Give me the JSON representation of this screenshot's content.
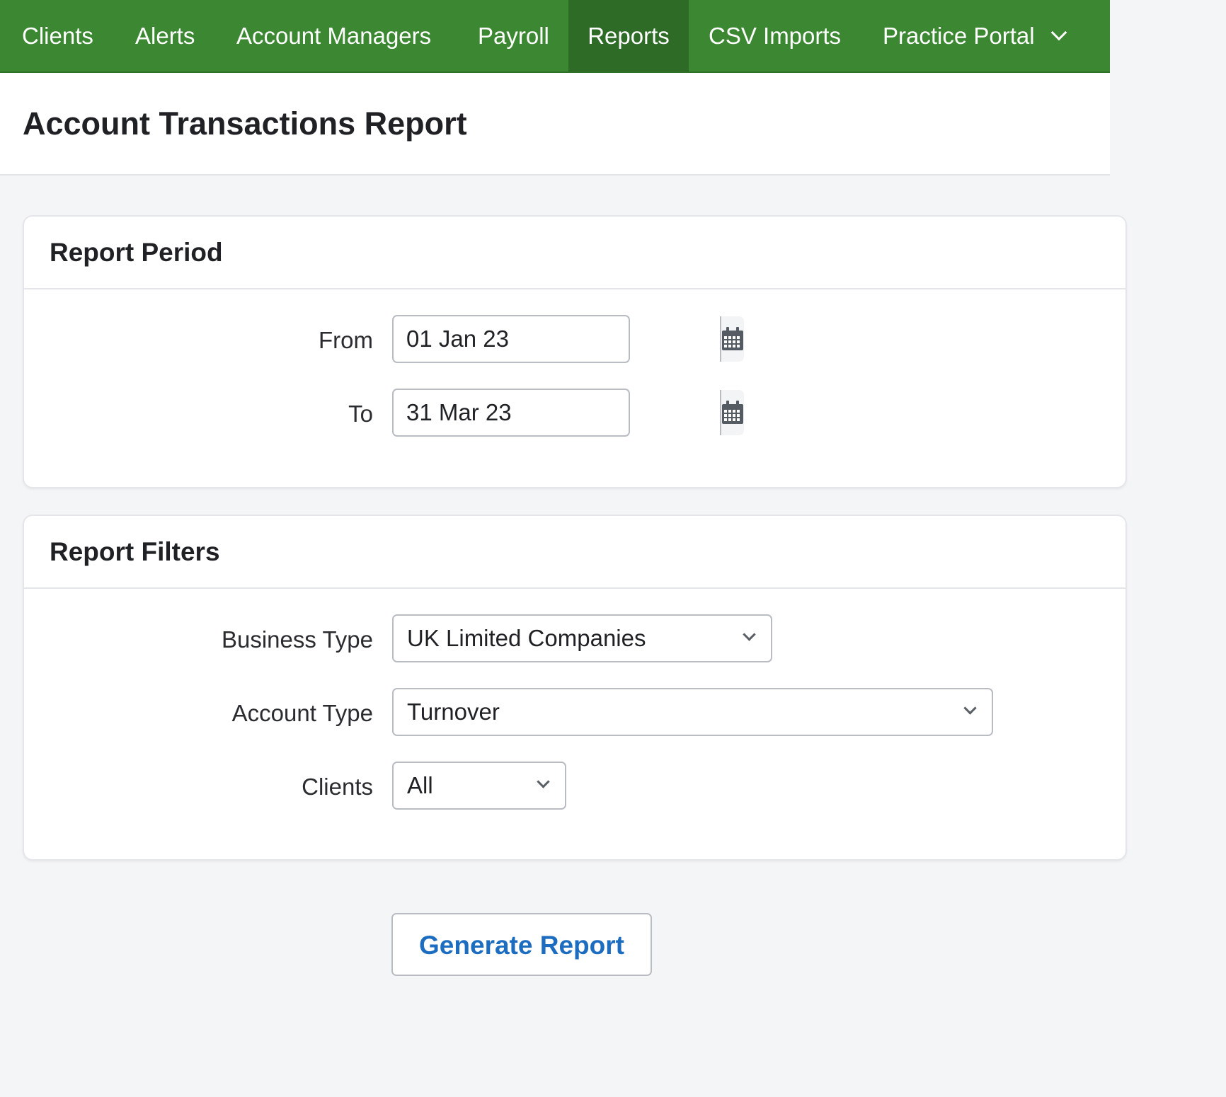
{
  "nav": {
    "items": [
      {
        "label": "Clients"
      },
      {
        "label": "Alerts"
      },
      {
        "label": "Account Managers"
      },
      {
        "label": "Payroll"
      },
      {
        "label": "Reports",
        "active": true
      },
      {
        "label": "CSV Imports"
      },
      {
        "label": "Practice Portal",
        "has_dropdown": true
      }
    ]
  },
  "page": {
    "title": "Account Transactions Report"
  },
  "report_period": {
    "title": "Report Period",
    "from": {
      "label": "From",
      "value": "01 Jan 23"
    },
    "to": {
      "label": "To",
      "value": "31 Mar 23"
    }
  },
  "report_filters": {
    "title": "Report Filters",
    "business_type": {
      "label": "Business Type",
      "value": "UK Limited Companies"
    },
    "account_type": {
      "label": "Account Type",
      "value": "Turnover"
    },
    "clients": {
      "label": "Clients",
      "value": "All"
    }
  },
  "actions": {
    "generate_label": "Generate Report"
  },
  "colors": {
    "nav_bg": "#3c8832",
    "nav_active_bg": "#2d6b26",
    "link_blue": "#1c6dc0",
    "page_bg": "#f4f5f7"
  }
}
